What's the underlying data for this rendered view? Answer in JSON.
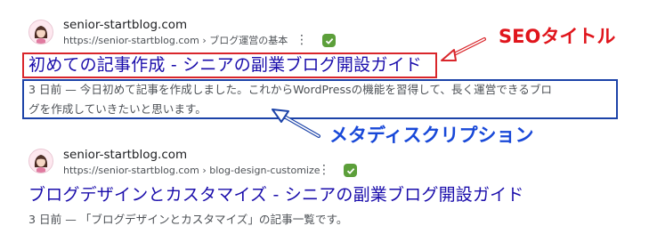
{
  "results": [
    {
      "site_name": "senior-startblog.com",
      "url": "https://senior-startblog.com › ブログ運営の基本",
      "title": "初めての記事作成 - シニアの副業ブログ開設ガイド",
      "snippet_line1": "3 日前 — 今日初めて記事を作成しました。これからWordPressの機能を習得して、長く運営できるブロ",
      "snippet_line2": "グを作成していきたいと思います。"
    },
    {
      "site_name": "senior-startblog.com",
      "url": "https://senior-startblog.com › blog-design-customize",
      "title": "ブログデザインとカスタマイズ - シニアの副業ブログ開設ガイド",
      "snippet_line1": "3 日前 — 「ブログデザインとカスタマイズ」の記事一覧です。"
    }
  ],
  "annotations": {
    "title_label": "SEOタイトル",
    "description_label": "メタディスクリプション",
    "title_color": "#d9262b",
    "description_color": "#1c43a8"
  },
  "icons": {
    "favicon": "avatar-favicon-icon",
    "menu": "more-vert-icon",
    "verified": "verified-check-icon"
  }
}
